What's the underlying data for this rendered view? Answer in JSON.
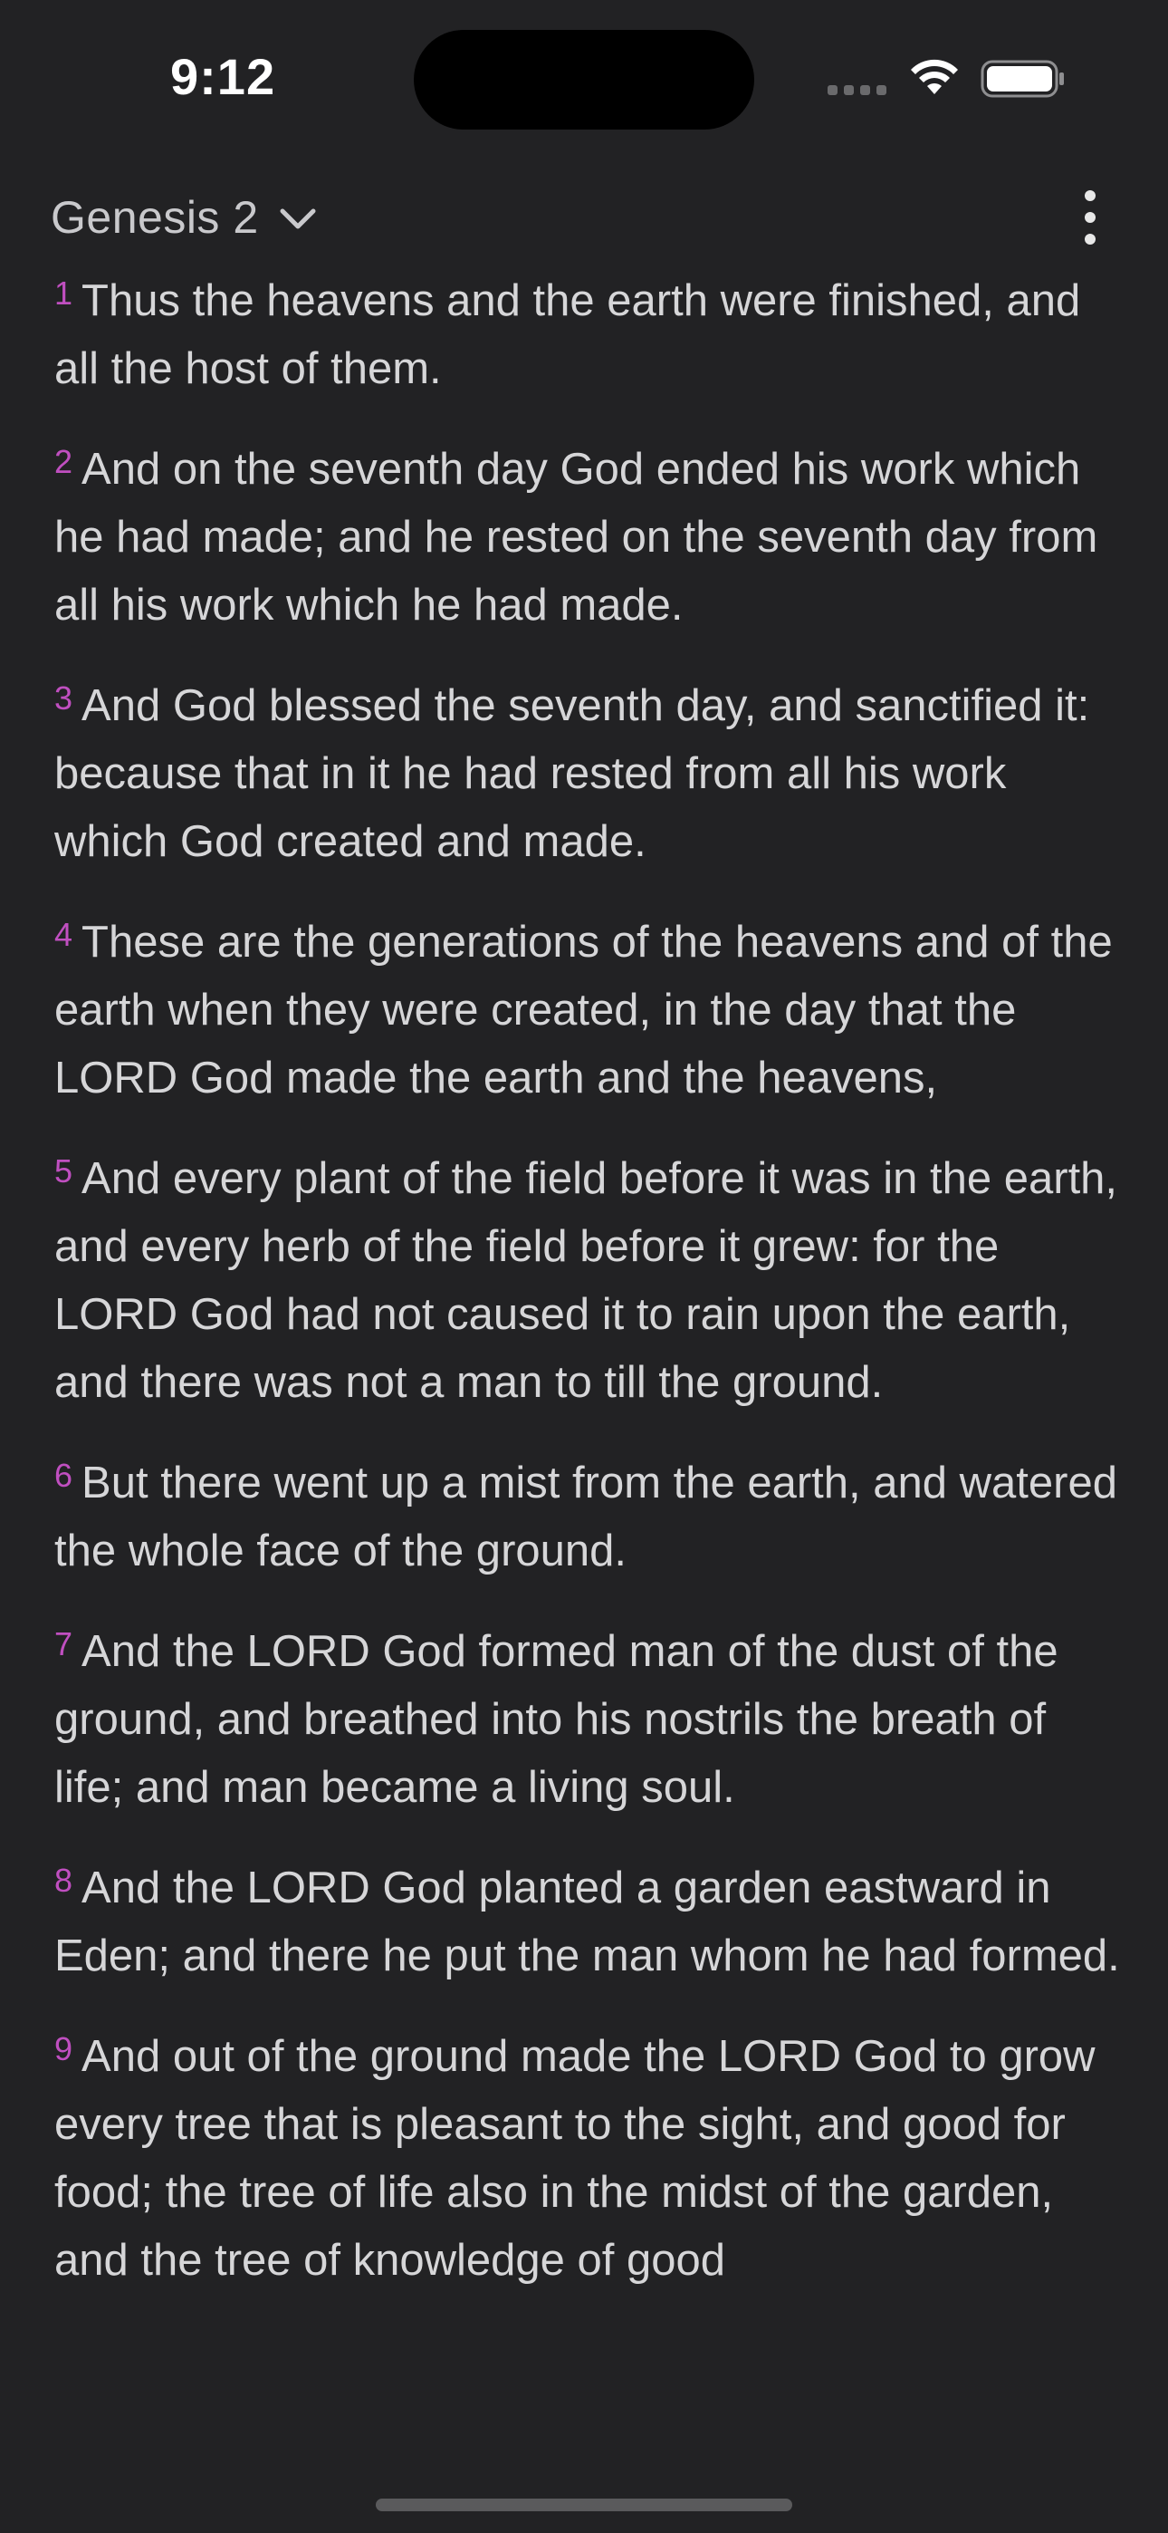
{
  "status_bar": {
    "time": "9:12"
  },
  "header": {
    "chapter_title": "Genesis 2"
  },
  "colors": {
    "background": "#222224",
    "verse_number": "#c04fc0",
    "text": "#d6d6d8"
  },
  "icons": {
    "chevron": "chevron-down-icon",
    "menu": "more-vertical-icon",
    "wifi": "wifi-icon",
    "battery": "battery-icon",
    "signal": "cellular-signal-icon"
  },
  "verses": [
    {
      "num": "1",
      "text": "Thus the heavens and the earth were finished, and all the host of them."
    },
    {
      "num": "2",
      "text": "And on the seventh day God ended his work which he had made; and he rested on the seventh day from all his work which he had made."
    },
    {
      "num": "3",
      "text": "And God blessed the seventh day, and sanctified it: because that in it he had rested from all his work which God created and made."
    },
    {
      "num": "4",
      "text": "These are the generations of the heavens and of the earth when they were created, in the day that the LORD God made the earth and the heavens,"
    },
    {
      "num": "5",
      "text": "And every plant of the field before it was in the earth, and every herb of the field before it grew: for the LORD God had not caused it to rain upon the earth, and there was not a man to till the ground."
    },
    {
      "num": "6",
      "text": "But there went up a mist from the earth, and watered the whole face of the ground."
    },
    {
      "num": "7",
      "text": "And the LORD God formed man of the dust of the ground, and breathed into his nostrils the breath of life; and man became a living soul."
    },
    {
      "num": "8",
      "text": "And the LORD God planted a garden eastward in Eden; and there he put the man whom he had formed."
    },
    {
      "num": "9",
      "text": "And out of the ground made the LORD God to grow every tree that is pleasant to the sight, and good for food; the tree of life also in the midst of the garden, and the tree of knowledge of good"
    }
  ]
}
